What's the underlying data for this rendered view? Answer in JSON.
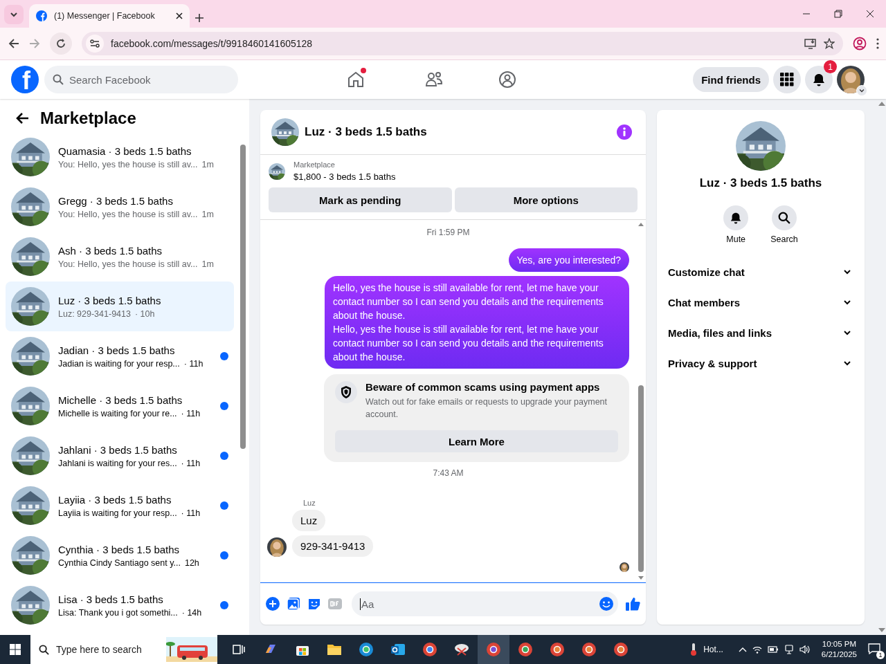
{
  "browser": {
    "tab_title": "(1) Messenger | Facebook",
    "url": "facebook.com/messages/t/9918460141605128"
  },
  "topbar": {
    "logo": "f",
    "search_placeholder": "Search Facebook",
    "home_notified": true,
    "find_friends": "Find friends",
    "notification_count": "1"
  },
  "sidebar": {
    "title": "Marketplace",
    "conversations": [
      {
        "name": "Quamasia · 3 beds 1.5 baths",
        "preview": "You: Hello, yes the house is still av...",
        "time": "1m",
        "selected": false,
        "unread": false
      },
      {
        "name": "Gregg · 3 beds 1.5 baths",
        "preview": "You: Hello, yes the house is still av...",
        "time": "1m",
        "selected": false,
        "unread": false
      },
      {
        "name": "Ash · 3 beds 1.5 baths",
        "preview": "You: Hello, yes the house is still av...",
        "time": "1m",
        "selected": false,
        "unread": false
      },
      {
        "name": "Luz · 3 beds 1.5 baths",
        "preview": "Luz: 929-341-9413",
        "time": "· 10h",
        "selected": true,
        "unread": false
      },
      {
        "name": "Jadian · 3 beds 1.5 baths",
        "preview": "Jadian is waiting for your resp...",
        "time": "· 11h",
        "selected": false,
        "unread": true
      },
      {
        "name": "Michelle · 3 beds 1.5 baths",
        "preview": "Michelle is waiting for your re...",
        "time": "· 11h",
        "selected": false,
        "unread": true
      },
      {
        "name": "Jahlani · 3 beds 1.5 baths",
        "preview": "Jahlani is waiting for your res...",
        "time": "· 11h",
        "selected": false,
        "unread": true
      },
      {
        "name": "Layiia · 3 beds 1.5 baths",
        "preview": "Layiia is waiting for your resp...",
        "time": "· 11h",
        "selected": false,
        "unread": true
      },
      {
        "name": "Cynthia · 3 beds 1.5 baths",
        "preview": "Cynthia Cindy Santiago sent y...",
        "time": "12h",
        "selected": false,
        "unread": true
      },
      {
        "name": "Lisa · 3 beds 1.5 baths",
        "preview": "Lisa: Thank you i got somethi...",
        "time": "· 14h",
        "selected": false,
        "unread": true
      }
    ]
  },
  "chat": {
    "title": "Luz · 3 beds 1.5 baths",
    "listing_label": "Marketplace",
    "listing_detail": "$1,800 - 3 beds 1.5 baths",
    "actions": [
      "Mark as pending",
      "More options"
    ],
    "messages": [
      {
        "kind": "time",
        "text": "Fri 1:59 PM"
      },
      {
        "kind": "outgoing",
        "text": "Yes, are you interested?"
      },
      {
        "kind": "outgoing",
        "text": "Hello, yes the house is still available for rent, let me have your contact number so I can send you details and the requirements about the house.\nHello, yes the house is still available for rent, let me have your contact number so I can send you details and the requirements about the house."
      },
      {
        "kind": "notice",
        "title": "Beware of common scams using payment apps",
        "body": "Watch out for fake emails or requests to upgrade your payment account.",
        "action": "Learn More"
      },
      {
        "kind": "time",
        "text": "7:43 AM"
      },
      {
        "kind": "sender",
        "text": "Luz"
      },
      {
        "kind": "incoming",
        "text": "Luz",
        "avatar": false
      },
      {
        "kind": "incoming",
        "text": "929-341-9413",
        "avatar": true
      },
      {
        "kind": "seen"
      }
    ],
    "composer_placeholder": "Aa"
  },
  "info": {
    "title": "Luz · 3 beds 1.5 baths",
    "actions": [
      {
        "label": "Mute",
        "kind": "bell"
      },
      {
        "label": "Search",
        "kind": "search"
      }
    ],
    "sections": [
      "Customize chat",
      "Chat members",
      "Media, files and links",
      "Privacy & support"
    ]
  },
  "taskbar": {
    "search_placeholder": "Type here to search",
    "weather": "Hot...",
    "time": "10:05 PM",
    "date": "6/21/2025",
    "notification_count": "1"
  }
}
